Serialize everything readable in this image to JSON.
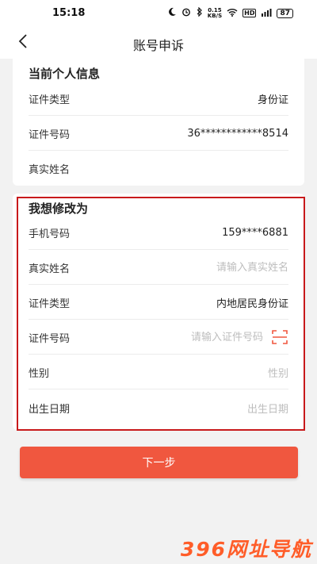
{
  "status_bar": {
    "time": "15:18",
    "net_speed_value": "0.15",
    "net_speed_unit": "KB/S",
    "hd_label": "HD",
    "battery": "87"
  },
  "nav": {
    "title": "账号申诉"
  },
  "current_info": {
    "title": "当前个人信息",
    "rows": [
      {
        "label": "证件类型",
        "value": "身份证"
      },
      {
        "label": "证件号码",
        "value": "36************8514"
      },
      {
        "label": "真实姓名",
        "value": ""
      }
    ]
  },
  "modify": {
    "title": "我想修改为",
    "phone": {
      "label": "手机号码",
      "value": "159****6881"
    },
    "real_name": {
      "label": "真实姓名",
      "placeholder": "请输入真实姓名"
    },
    "id_type": {
      "label": "证件类型",
      "value": "内地居民身份证"
    },
    "id_number": {
      "label": "证件号码",
      "placeholder": "请输入证件号码"
    },
    "gender": {
      "label": "性别",
      "placeholder": "性别"
    },
    "birth_date": {
      "label": "出生日期",
      "placeholder": "出生日期"
    }
  },
  "actions": {
    "next_label": "下一步"
  },
  "watermark": "396网址导航",
  "colors": {
    "accent": "#f0573f",
    "highlight_frame": "#c8191b",
    "placeholder": "#bdbdbd"
  }
}
